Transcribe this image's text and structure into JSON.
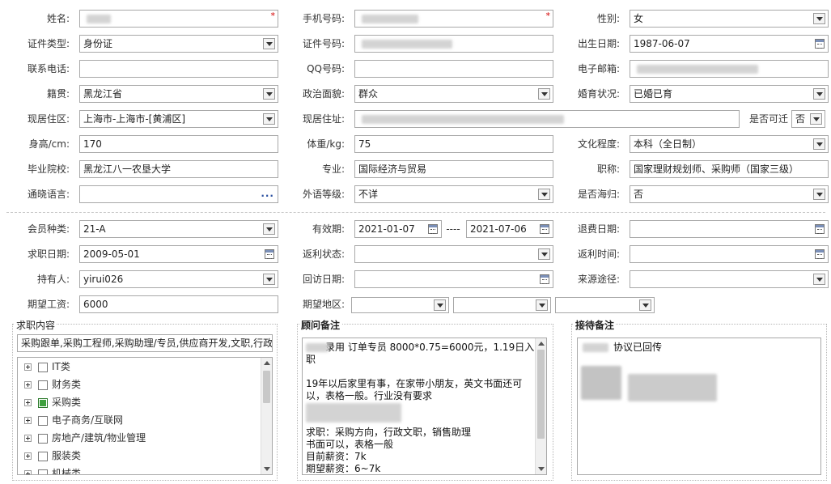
{
  "row1": {
    "name_label": "姓名:",
    "phone_label": "手机号码:",
    "gender_label": "性别:",
    "gender_value": "女",
    "required_mark": "*"
  },
  "row2": {
    "idtype_label": "证件类型:",
    "idtype_value": "身份证",
    "idno_label": "证件号码:",
    "birth_label": "出生日期:",
    "birth_value": "1987-06-07"
  },
  "row3": {
    "tel_label": "联系电话:",
    "qq_label": "QQ号码:",
    "email_label": "电子邮箱:"
  },
  "row4": {
    "native_label": "籍贯:",
    "native_value": "黑龙江省",
    "politics_label": "政治面貌:",
    "politics_value": "群众",
    "marital_label": "婚育状况:",
    "marital_value": "已婚已育"
  },
  "row5": {
    "residence_label": "现居住区:",
    "residence_value": "上海市-上海市-[黄浦区]",
    "address_label": "现居住址:",
    "relocate_label": "是否可迁",
    "relocate_value": "否"
  },
  "row6": {
    "height_label": "身高/cm:",
    "height_value": "170",
    "weight_label": "体重/kg:",
    "weight_value": "75",
    "education_label": "文化程度:",
    "education_value": "本科（全日制）"
  },
  "row7": {
    "school_label": "毕业院校:",
    "school_value": "黑龙江八一农垦大学",
    "major_label": "专业:",
    "major_value": "国际经济与贸易",
    "title_label": "职称:",
    "title_value": "国家理财规划师、采购师（国家三级）"
  },
  "row8": {
    "language_label": "通晓语言:",
    "language_button": "···",
    "foreign_label": "外语等级:",
    "foreign_value": "不详",
    "overseas_label": "是否海归:",
    "overseas_value": "否"
  },
  "membership": {
    "type_label": "会员种类:",
    "type_value": "21-A",
    "valid_label": "有效期:",
    "valid_from": "2021-01-07",
    "valid_sep": "----",
    "valid_to": "2021-07-06",
    "refund_label": "退费日期:",
    "jobdate_label": "求职日期:",
    "jobdate_value": "2009-05-01",
    "rebate_status_label": "返利状态:",
    "rebate_time_label": "返利时间:",
    "holder_label": "持有人:",
    "holder_value": "yirui026",
    "visit_label": "回访日期:",
    "source_label": "来源途径:",
    "salary_label": "期望工资:",
    "salary_value": "6000",
    "area_label": "期望地区:"
  },
  "job_panel": {
    "title": "求职内容",
    "summary": "采购跟单,采购工程师,采购助理/专员,供应商开发,文职,行政",
    "categories": [
      {
        "label": "IT类",
        "checked": false
      },
      {
        "label": "财务类",
        "checked": false
      },
      {
        "label": "采购类",
        "checked": true
      },
      {
        "label": "电子商务/互联网",
        "checked": false
      },
      {
        "label": "房地产/建筑/物业管理",
        "checked": false
      },
      {
        "label": "服装类",
        "checked": false
      },
      {
        "label": "机械类",
        "checked": false
      }
    ]
  },
  "consultant_panel": {
    "title": "顾问备注",
    "lines": [
      "录用 订单专员  8000*0.75=6000元，1.19日入",
      "职",
      "",
      "19年以后家里有事，在家带小朋友，英文书面还可",
      "以，表格一般。行业没有要求",
      "",
      "",
      "求职：采购方向，行政文职，销售助理",
      "书面可以，表格一般",
      "目前薪资：7k",
      "期望薪资：6~7k"
    ]
  },
  "reception_panel": {
    "title": "接待备注",
    "lines": [
      "协议已回传"
    ]
  }
}
